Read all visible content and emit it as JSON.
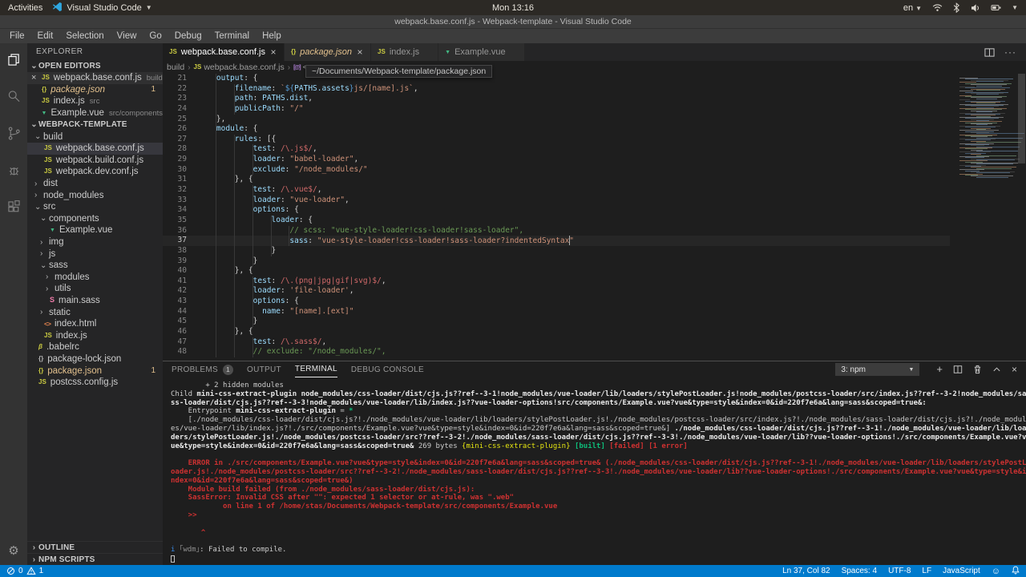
{
  "top_bar": {
    "activities": "Activities",
    "app": "Visual Studio Code",
    "clock": "Mon 13:16",
    "lang": "en"
  },
  "title_bar": {
    "title": "webpack.base.conf.js - Webpack-template - Visual Studio Code"
  },
  "menu_bar": {
    "items": [
      "File",
      "Edit",
      "Selection",
      "View",
      "Go",
      "Debug",
      "Terminal",
      "Help"
    ]
  },
  "explorer": {
    "title": "EXPLORER",
    "open_editors": {
      "label": "OPEN EDITORS",
      "items": [
        {
          "icon": "js",
          "name": "webpack.base.conf.js",
          "detail": "build",
          "active": true,
          "close": true
        },
        {
          "icon": "json",
          "name": "package.json",
          "gold": true,
          "italic": true,
          "badge": "1"
        },
        {
          "icon": "js",
          "name": "index.js",
          "detail": "src"
        },
        {
          "icon": "vue",
          "name": "Example.vue",
          "detail": "src/components"
        }
      ]
    },
    "tree": {
      "label": "WEBPACK-TEMPLATE",
      "items": [
        {
          "type": "folder",
          "state": "open",
          "name": "build",
          "level": 0
        },
        {
          "type": "file",
          "icon": "js",
          "name": "webpack.base.conf.js",
          "level": 1,
          "selected": true
        },
        {
          "type": "file",
          "icon": "js",
          "name": "webpack.build.conf.js",
          "level": 1
        },
        {
          "type": "file",
          "icon": "js",
          "name": "webpack.dev.conf.js",
          "level": 1
        },
        {
          "type": "folder",
          "state": "closed",
          "name": "dist",
          "level": 0
        },
        {
          "type": "folder",
          "state": "closed",
          "name": "node_modules",
          "level": 0
        },
        {
          "type": "folder",
          "state": "open",
          "name": "src",
          "level": 0
        },
        {
          "type": "folder",
          "state": "open",
          "name": "components",
          "level": 1
        },
        {
          "type": "file",
          "icon": "vue",
          "name": "Example.vue",
          "level": 2
        },
        {
          "type": "folder",
          "state": "closed",
          "name": "img",
          "level": 1
        },
        {
          "type": "folder",
          "state": "closed",
          "name": "js",
          "level": 1
        },
        {
          "type": "folder",
          "state": "open",
          "name": "sass",
          "level": 1
        },
        {
          "type": "folder",
          "state": "closed",
          "name": "modules",
          "level": 2
        },
        {
          "type": "folder",
          "state": "closed",
          "name": "utils",
          "level": 2
        },
        {
          "type": "file",
          "icon": "sass",
          "name": "main.sass",
          "level": 2
        },
        {
          "type": "folder",
          "state": "closed",
          "name": "static",
          "level": 1
        },
        {
          "type": "file",
          "icon": "html",
          "name": "index.html",
          "level": 1
        },
        {
          "type": "file",
          "icon": "js",
          "name": "index.js",
          "level": 1
        },
        {
          "type": "file",
          "icon": "babel",
          "name": ".babelrc",
          "level": 0
        },
        {
          "type": "file",
          "icon": "jsong",
          "name": "package-lock.json",
          "level": 0
        },
        {
          "type": "file",
          "icon": "json",
          "name": "package.json",
          "level": 0,
          "gold": true,
          "badge": "1"
        },
        {
          "type": "file",
          "icon": "js",
          "name": "postcss.config.js",
          "level": 0
        }
      ]
    },
    "bottom_sections": [
      "OUTLINE",
      "NPM SCRIPTS"
    ]
  },
  "tabs": [
    {
      "icon": "js",
      "label": "webpack.base.conf.js",
      "active": true,
      "close": true
    },
    {
      "icon": "json",
      "label": "package.json",
      "italic": true,
      "gold": true,
      "close": true
    },
    {
      "icon": "js",
      "label": "index.js"
    },
    {
      "icon": "vue",
      "label": "Example.vue"
    }
  ],
  "editor": {
    "breadcrumb": [
      {
        "label": "build"
      },
      {
        "label": "webpack.base.conf.js",
        "icon": "js"
      },
      {
        "label": "<ur",
        "icon": "sym"
      }
    ],
    "tooltip": "~/Documents/Webpack-template/package.json",
    "active_line": 37,
    "lines": [
      {
        "n": 21,
        "seg": [
          [
            "    ",
            ""
          ],
          [
            "output",
            "prop"
          ],
          [
            ": {",
            "punct"
          ]
        ]
      },
      {
        "n": 22,
        "seg": [
          [
            "        ",
            ""
          ],
          [
            "filename",
            "prop"
          ],
          [
            ": ",
            "punct"
          ],
          [
            "`",
            "string"
          ],
          [
            "${",
            "texpr"
          ],
          [
            "PATHS.assets",
            "var"
          ],
          [
            "}",
            "texpr"
          ],
          [
            "js/[name].js`",
            "string"
          ],
          [
            ",",
            "punct"
          ]
        ]
      },
      {
        "n": 23,
        "seg": [
          [
            "        ",
            ""
          ],
          [
            "path",
            "prop"
          ],
          [
            ": ",
            "punct"
          ],
          [
            "PATHS.dist",
            "var"
          ],
          [
            ",",
            "punct"
          ]
        ]
      },
      {
        "n": 24,
        "seg": [
          [
            "        ",
            ""
          ],
          [
            "publicPath",
            "prop"
          ],
          [
            ": ",
            "punct"
          ],
          [
            "\"/\"",
            "string"
          ]
        ]
      },
      {
        "n": 25,
        "seg": [
          [
            "    ",
            ""
          ],
          [
            "},",
            "punct"
          ]
        ]
      },
      {
        "n": 26,
        "seg": [
          [
            "    ",
            ""
          ],
          [
            "module",
            "prop"
          ],
          [
            ": {",
            "punct"
          ]
        ]
      },
      {
        "n": 27,
        "seg": [
          [
            "        ",
            ""
          ],
          [
            "rules",
            "prop"
          ],
          [
            ": [{",
            "punct"
          ]
        ]
      },
      {
        "n": 28,
        "seg": [
          [
            "            ",
            ""
          ],
          [
            "test",
            "prop"
          ],
          [
            ": ",
            "punct"
          ],
          [
            "/\\.js$/",
            "regex"
          ],
          [
            ",",
            "punct"
          ]
        ]
      },
      {
        "n": 29,
        "seg": [
          [
            "            ",
            ""
          ],
          [
            "loader",
            "prop"
          ],
          [
            ": ",
            "punct"
          ],
          [
            "\"babel-loader\"",
            "string"
          ],
          [
            ",",
            "punct"
          ]
        ]
      },
      {
        "n": 30,
        "seg": [
          [
            "            ",
            ""
          ],
          [
            "exclude",
            "prop"
          ],
          [
            ": ",
            "punct"
          ],
          [
            "\"/node_modules/\"",
            "string"
          ]
        ]
      },
      {
        "n": 31,
        "seg": [
          [
            "        ",
            ""
          ],
          [
            "}, {",
            "punct"
          ]
        ]
      },
      {
        "n": 32,
        "seg": [
          [
            "            ",
            ""
          ],
          [
            "test",
            "prop"
          ],
          [
            ": ",
            "punct"
          ],
          [
            "/\\.vue$/",
            "regex"
          ],
          [
            ",",
            "punct"
          ]
        ]
      },
      {
        "n": 33,
        "seg": [
          [
            "            ",
            ""
          ],
          [
            "loader",
            "prop"
          ],
          [
            ": ",
            "punct"
          ],
          [
            "\"vue-loader\"",
            "string"
          ],
          [
            ",",
            "punct"
          ]
        ]
      },
      {
        "n": 34,
        "seg": [
          [
            "            ",
            ""
          ],
          [
            "options",
            "prop"
          ],
          [
            ": {",
            "punct"
          ]
        ]
      },
      {
        "n": 35,
        "seg": [
          [
            "                ",
            ""
          ],
          [
            "loader",
            "prop"
          ],
          [
            ": {",
            "punct"
          ]
        ]
      },
      {
        "n": 36,
        "seg": [
          [
            "                    ",
            ""
          ],
          [
            "// scss: \"vue-style-loader!css-loader!sass-loader\",",
            "comment"
          ]
        ]
      },
      {
        "n": 37,
        "seg": [
          [
            "                    ",
            ""
          ],
          [
            "sass",
            "prop"
          ],
          [
            ": ",
            "punct"
          ],
          [
            "\"vue-style-loader!css-loader!sass-loader?indentedSyntax",
            "string"
          ],
          [
            "",
            "cursor"
          ],
          [
            "\"",
            "string"
          ]
        ]
      },
      {
        "n": 38,
        "seg": [
          [
            "                ",
            ""
          ],
          [
            "}",
            "punct"
          ]
        ]
      },
      {
        "n": 39,
        "seg": [
          [
            "            ",
            ""
          ],
          [
            "}",
            "punct"
          ]
        ]
      },
      {
        "n": 40,
        "seg": [
          [
            "        ",
            ""
          ],
          [
            "}, {",
            "punct"
          ]
        ]
      },
      {
        "n": 41,
        "seg": [
          [
            "            ",
            ""
          ],
          [
            "test",
            "prop"
          ],
          [
            ": ",
            "punct"
          ],
          [
            "/\\.(png|jpg|gif|svg)$/",
            "regex"
          ],
          [
            ",",
            "punct"
          ]
        ]
      },
      {
        "n": 42,
        "seg": [
          [
            "            ",
            ""
          ],
          [
            "loader",
            "prop"
          ],
          [
            ": ",
            "punct"
          ],
          [
            "'file-loader'",
            "string"
          ],
          [
            ",",
            "punct"
          ]
        ]
      },
      {
        "n": 43,
        "seg": [
          [
            "            ",
            ""
          ],
          [
            "options",
            "prop"
          ],
          [
            ": {",
            "punct"
          ]
        ]
      },
      {
        "n": 44,
        "seg": [
          [
            "              ",
            ""
          ],
          [
            "name",
            "prop"
          ],
          [
            ": ",
            "punct"
          ],
          [
            "\"[name].[ext]\"",
            "string"
          ]
        ]
      },
      {
        "n": 45,
        "seg": [
          [
            "            ",
            ""
          ],
          [
            "}",
            "punct"
          ]
        ]
      },
      {
        "n": 46,
        "seg": [
          [
            "        ",
            ""
          ],
          [
            "}, {",
            "punct"
          ]
        ]
      },
      {
        "n": 47,
        "seg": [
          [
            "            ",
            ""
          ],
          [
            "test",
            "prop"
          ],
          [
            ": ",
            "punct"
          ],
          [
            "/\\.sass$/",
            "regex"
          ],
          [
            ",",
            "punct"
          ]
        ]
      },
      {
        "n": 48,
        "seg": [
          [
            "            ",
            ""
          ],
          [
            "// exclude: \"/node_modules/\",",
            "comment"
          ]
        ]
      }
    ]
  },
  "panel": {
    "tabs": [
      {
        "label": "PROBLEMS",
        "badge": "1"
      },
      {
        "label": "OUTPUT"
      },
      {
        "label": "TERMINAL",
        "active": true
      },
      {
        "label": "DEBUG CONSOLE"
      }
    ],
    "selector": "3: npm"
  },
  "terminal": {
    "lines": [
      [
        [
          "        + 2 hidden modules",
          ""
        ]
      ],
      [
        [
          "Child ",
          ""
        ],
        [
          "mini-css-extract-plugin",
          "b"
        ],
        [
          " ",
          ""
        ],
        [
          "node_modules/css-loader/dist/cjs.js??ref--3-1!node_modules/vue-loader/lib/loaders/stylePostLoader.js!node_modules/postcss-loader/src/index.js??ref--3-2!node_modules/sa",
          "b"
        ]
      ],
      [
        [
          "ss-loader/dist/cjs.js??ref--3-3!node_modules/vue-loader/lib/index.js??vue-loader-options!src/components/Example.vue?vue&type=style&index=0&id=220f7e6a&lang=sass&scoped=true&:",
          "b"
        ]
      ],
      [
        [
          "    Entrypoint ",
          ""
        ],
        [
          "mini-css-extract-plugin",
          "b"
        ],
        [
          " = ",
          ""
        ],
        [
          "*",
          "green"
        ]
      ],
      [
        [
          "    [./node_modules/css-loader/dist/cjs.js?!./node_modules/vue-loader/lib/loaders/stylePostLoader.js!./node_modules/postcss-loader/src/index.js?!./node_modules/sass-loader/dist/cjs.js?!./node_modul",
          ""
        ]
      ],
      [
        [
          "es/vue-loader/lib/index.js?!./src/components/Example.vue?vue&type=style&index=0&id=220f7e6a&lang=sass&scoped=true&] ",
          ""
        ],
        [
          "./node_modules/css-loader/dist/cjs.js??ref--3-1!./node_modules/vue-loader/lib/loa",
          "b"
        ]
      ],
      [
        [
          "ders/stylePostLoader.js!./node_modules/postcss-loader/src??ref--3-2!./node_modules/sass-loader/dist/cjs.js??ref--3-3!./node_modules/vue-loader/lib??vue-loader-options!./src/components/Example.vue?v",
          "b"
        ]
      ],
      [
        [
          "ue&type=style&index=0&id=220f7e6a&lang=sass&scoped=true&",
          "b"
        ],
        [
          " 269 bytes ",
          ""
        ],
        [
          "{mini-css-extract-plugin}",
          "yellow"
        ],
        [
          " ",
          ""
        ],
        [
          "[built]",
          "green"
        ],
        [
          " ",
          ""
        ],
        [
          "[failed]",
          "red"
        ],
        [
          " ",
          ""
        ],
        [
          "[1 error]",
          "red"
        ]
      ],
      [],
      [
        [
          "    ERROR in ./src/components/Example.vue?vue&type=style&index=0&id=220f7e6a&lang=sass&scoped=true& (./node_modules/css-loader/dist/cjs.js??ref--3-1!./node_modules/vue-loader/lib/loaders/stylePostL",
          "red"
        ]
      ],
      [
        [
          "oader.js!./node_modules/postcss-loader/src??ref--3-2!./node_modules/sass-loader/dist/cjs.js??ref--3-3!./node_modules/vue-loader/lib??vue-loader-options!./src/components/Example.vue?vue&type=style&i",
          "red"
        ]
      ],
      [
        [
          "ndex=0&id=220f7e6a&lang=sass&scoped=true&)",
          "red"
        ]
      ],
      [
        [
          "    Module build failed (from ./node_modules/sass-loader/dist/cjs.js):",
          "red"
        ]
      ],
      [
        [
          "    SassError: Invalid CSS after \"\": expected 1 selector or at-rule, was \".web\"",
          "red"
        ]
      ],
      [
        [
          "            on line 1 of /home/stas/Documents/Webpack-template/src/components/Example.vue",
          "red"
        ]
      ],
      [
        [
          "    >>",
          "red"
        ]
      ],
      [],
      [
        [
          "       ^",
          "red"
        ]
      ],
      [],
      [
        [
          "i",
          "blue"
        ],
        [
          " ｢wdm｣",
          "dim"
        ],
        [
          ": Failed to compile.",
          ""
        ]
      ]
    ]
  },
  "status_bar": {
    "errors": "0",
    "warnings": "1",
    "items": [
      "Ln 37, Col 82",
      "Spaces: 4",
      "UTF-8",
      "LF",
      "JavaScript"
    ]
  }
}
